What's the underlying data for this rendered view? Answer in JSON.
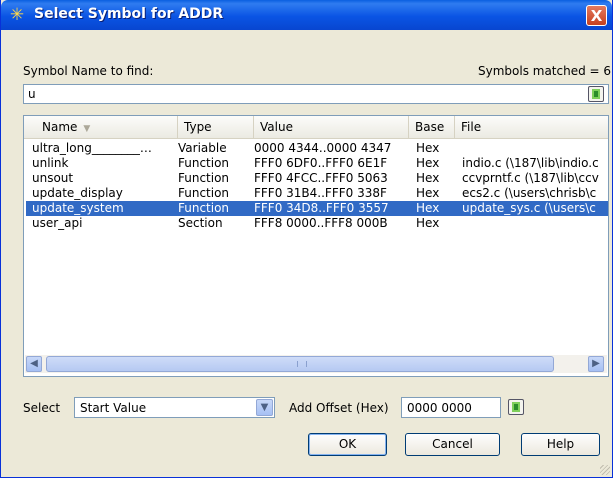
{
  "window": {
    "title": "Select Symbol for ADDR",
    "close_glyph": "X",
    "icon": "asterisk-symbol-icon"
  },
  "search": {
    "label": "Symbol Name to find:",
    "matched": "Symbols matched = 6",
    "value": "u"
  },
  "columns": [
    "Name",
    "Type",
    "Value",
    "Base",
    "File"
  ],
  "rows": [
    {
      "name": "ultra_long________…",
      "type": "Variable",
      "value": "0000 4344..0000 4347",
      "base": "Hex",
      "file": "",
      "selected": false
    },
    {
      "name": "unlink",
      "type": "Function",
      "value": "FFF0 6DF0..FFF0 6E1F",
      "base": "Hex",
      "file": "indio.c (\\187\\lib\\indio.c",
      "selected": false
    },
    {
      "name": "unsout",
      "type": "Function",
      "value": "FFF0 4FCC..FFF0 5063",
      "base": "Hex",
      "file": "ccvprntf.c (\\187\\lib\\ccv",
      "selected": false
    },
    {
      "name": "update_display",
      "type": "Function",
      "value": "FFF0 31B4..FFF0 338F",
      "base": "Hex",
      "file": "ecs2.c (\\users\\chrisb\\c",
      "selected": false
    },
    {
      "name": "update_system",
      "type": "Function",
      "value": "FFF0 34D8..FFF0 3557",
      "base": "Hex",
      "file": "update_sys.c (\\users\\c",
      "selected": true
    },
    {
      "name": "user_api",
      "type": "Section",
      "value": "FFF8 0000..FFF8 000B",
      "base": "Hex",
      "file": "",
      "selected": false
    }
  ],
  "select": {
    "label": "Select",
    "value": "Start Value"
  },
  "offset": {
    "label": "Add Offset (Hex)",
    "value": "0000 0000"
  },
  "buttons": {
    "ok": "OK",
    "cancel": "Cancel",
    "help": "Help"
  },
  "colors": {
    "titlebar": "#0a54e4",
    "selection": "#316ac5",
    "dialog_bg": "#ece9d8"
  }
}
